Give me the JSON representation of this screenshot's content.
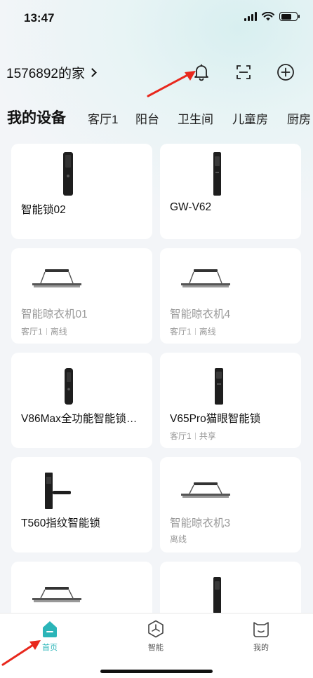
{
  "status": {
    "time": "13:47"
  },
  "header": {
    "home_name": "1576892的家"
  },
  "tabs": [
    "我的设备",
    "客厅1",
    "阳台",
    "卫生间",
    "儿童房",
    "厨房"
  ],
  "devices": [
    {
      "name": "智能锁02",
      "type": "lock",
      "offline": false,
      "room": "",
      "status": ""
    },
    {
      "name": "GW-V62",
      "type": "lock-slim",
      "offline": false,
      "room": "",
      "status": ""
    },
    {
      "name": "智能晾衣机01",
      "type": "dryer",
      "offline": true,
      "room": "客厅1",
      "status": "离线"
    },
    {
      "name": "智能晾衣机4",
      "type": "dryer",
      "offline": true,
      "room": "客厅1",
      "status": "离线"
    },
    {
      "name": "V86Max全功能智能锁…",
      "type": "lock",
      "offline": false,
      "room": "",
      "status": ""
    },
    {
      "name": "V65Pro猫眼智能锁",
      "type": "lock-slim",
      "offline": false,
      "room": "客厅1",
      "status": "共享"
    },
    {
      "name": "T560指纹智能锁",
      "type": "lock-lever",
      "offline": false,
      "room": "",
      "status": ""
    },
    {
      "name": "智能晾衣机3",
      "type": "dryer",
      "offline": true,
      "room": "",
      "status": "离线"
    },
    {
      "name": "",
      "type": "dryer",
      "offline": false,
      "room": "",
      "status": ""
    },
    {
      "name": "",
      "type": "lock-slim",
      "offline": false,
      "room": "",
      "status": ""
    }
  ],
  "tabbar": {
    "home": "首页",
    "smart": "智能",
    "mine": "我的"
  },
  "colors": {
    "accent": "#2bb5b8",
    "annotation": "#e8281d"
  },
  "icons": [
    "bell-icon",
    "scan-icon",
    "add-icon",
    "home-tab-icon",
    "smart-tab-icon",
    "mine-tab-icon"
  ]
}
